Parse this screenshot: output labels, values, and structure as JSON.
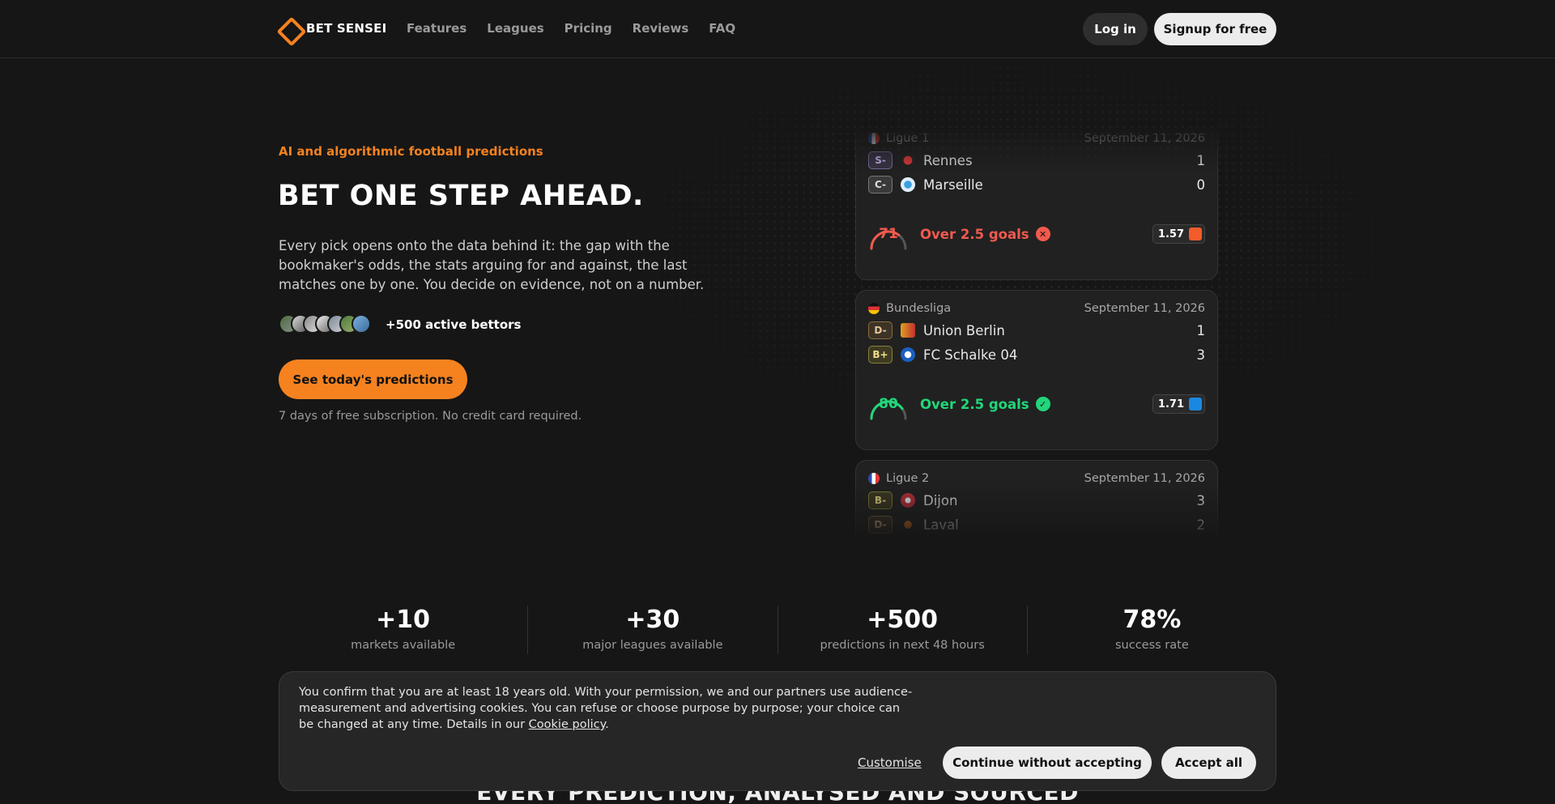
{
  "nav": {
    "brand": "BET SENSEI",
    "links": [
      "Features",
      "Leagues",
      "Pricing",
      "Reviews",
      "FAQ"
    ],
    "login_label": "Log in",
    "signup_label": "Signup for free"
  },
  "hero": {
    "eyebrow": "AI and algorithmic football predictions",
    "title": "BET ONE STEP AHEAD.",
    "description": "Every pick opens onto the data behind it: the gap with the bookmaker's odds, the stats arguing for and against, the last matches one by one. You decide on evidence, not on a number.",
    "bettors": "+500 active bettors",
    "cta_label": "See today's predictions",
    "cta_note": "7 days of free subscription. No credit card required."
  },
  "cards": [
    {
      "league": "Ligue 1",
      "date": "September 11, 2026",
      "home": {
        "grade": "S-",
        "name": "Rennes",
        "score": "1"
      },
      "away": {
        "grade": "C-",
        "name": "Marseille",
        "score": "0"
      },
      "confidence": 71,
      "prediction": "Over 2.5 goals",
      "result": "lost",
      "odds": "1.57",
      "colors": {
        "accent": "#f05a4e",
        "bookmaker": "#f25c2a"
      }
    },
    {
      "league": "Bundesliga",
      "date": "September 11, 2026",
      "home": {
        "grade": "D-",
        "name": "Union Berlin",
        "score": "1"
      },
      "away": {
        "grade": "B+",
        "name": "FC Schalke 04",
        "score": "3"
      },
      "confidence": 80,
      "prediction": "Over 2.5 goals",
      "result": "won",
      "odds": "1.71",
      "colors": {
        "accent": "#22d67a",
        "bookmaker": "#1a88e0"
      }
    },
    {
      "league": "Ligue 2",
      "date": "September 11, 2026",
      "home": {
        "grade": "B-",
        "name": "Dijon",
        "score": "3"
      },
      "away": {
        "grade": "D-",
        "name": "Laval",
        "score": "2"
      }
    }
  ],
  "stats": [
    {
      "value": "+10",
      "label": "markets available"
    },
    {
      "value": "+30",
      "label": "major leagues available"
    },
    {
      "value": "+500",
      "label": "predictions in next 48 hours"
    },
    {
      "value": "78%",
      "label": "success rate"
    }
  ],
  "section_title": "EVERY PREDICTION, ANALYSED AND SOURCED",
  "cookie": {
    "text": "You confirm that you are at least 18 years old. With your permission, we and our partners use audience-measurement and advertising cookies. You can refuse or choose purpose by purpose; your choice can be changed at any time. Details in our ",
    "link": "Cookie policy",
    "end": ".",
    "customise_label": "Customise",
    "continue_label": "Continue without accepting",
    "accept_label": "Accept all"
  },
  "theme": {
    "accent": "#f5821f",
    "background": "#161616"
  }
}
